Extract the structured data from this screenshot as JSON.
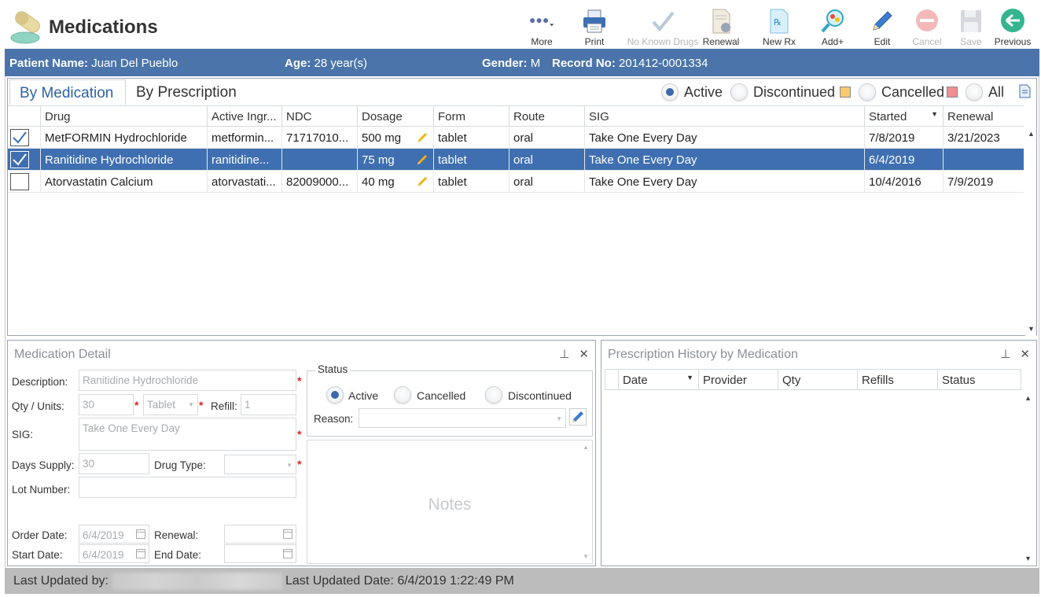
{
  "app": {
    "title": "Medications"
  },
  "toolbar": {
    "more": "More",
    "print": "Print",
    "no_known_drugs": "No Known Drugs",
    "renewal": "Renewal",
    "new_rx": "New Rx",
    "add": "Add+",
    "edit": "Edit",
    "cancel": "Cancel",
    "save": "Save",
    "previous": "Previous"
  },
  "patient": {
    "name_label": "Patient Name:",
    "name": "Juan Del Pueblo",
    "age_label": "Age:",
    "age": "28 year(s)",
    "gender_label": "Gender:",
    "gender": "M",
    "record_label": "Record No:",
    "record": "201412-0001334"
  },
  "tabs": {
    "by_medication": "By Medication",
    "by_prescription": "By Prescription"
  },
  "filters": {
    "active": "Active",
    "discontinued": "Discontinued",
    "cancelled": "Cancelled",
    "all": "All",
    "discontinued_color": "#f7c970",
    "cancelled_color": "#ef8f92",
    "selected": "Active"
  },
  "grid": {
    "headers": [
      "Drug",
      "Active Ingr...",
      "NDC",
      "Dosage",
      "Form",
      "Route",
      "SIG",
      "Started",
      "Renewal"
    ],
    "rows": [
      {
        "checked": true,
        "drug": "MetFORMIN Hydrochloride",
        "ingredient": "metformin...",
        "ndc": "71717010...",
        "dosage": "500 mg",
        "form": "tablet",
        "route": "oral",
        "sig": "Take One Every Day",
        "started": "7/8/2019",
        "renewal": "3/21/2023"
      },
      {
        "checked": true,
        "drug": "Ranitidine Hydrochloride",
        "ingredient": "ranitidine...",
        "ndc": "",
        "dosage": "75 mg",
        "form": "tablet",
        "route": "oral",
        "sig": "Take One Every Day",
        "started": "6/4/2019",
        "renewal": "",
        "selected": true
      },
      {
        "checked": false,
        "drug": "Atorvastatin Calcium",
        "ingredient": "atorvastati...",
        "ndc": "82009000...",
        "dosage": "40 mg",
        "form": "tablet",
        "route": "oral",
        "sig": "Take One Every Day",
        "started": "10/4/2016",
        "renewal": "7/9/2019"
      }
    ]
  },
  "detail": {
    "title": "Medication Detail",
    "description_label": "Description:",
    "description": "Ranitidine Hydrochloride",
    "qty_label": "Qty / Units:",
    "qty": "30",
    "units": "Tablet",
    "refill_label": "Refill:",
    "refill": "1",
    "sig_label": "SIG:",
    "sig": "Take One Every Day",
    "days_label": "Days Supply:",
    "days": "30",
    "drug_type_label": "Drug Type:",
    "drug_type": "",
    "lot_label": "Lot Number:",
    "lot": "",
    "order_date_label": "Order Date:",
    "order_date": "6/4/2019",
    "renewal_label": "Renewal:",
    "renewal": "",
    "start_date_label": "Start Date:",
    "start_date": "6/4/2019",
    "end_date_label": "End Date:",
    "end_date": "",
    "status_legend": "Status",
    "status_active": "Active",
    "status_cancelled": "Cancelled",
    "status_discontinued": "Discontinued",
    "reason_label": "Reason:",
    "reason": "",
    "notes_placeholder": "Notes"
  },
  "history": {
    "title": "Prescription History by Medication",
    "headers": [
      "Date",
      "Provider",
      "Qty",
      "Refills",
      "Status"
    ]
  },
  "footer": {
    "updated_by_label": "Last Updated by:",
    "updated_date_label": "Last Updated Date:",
    "updated_date": "6/4/2019 1:22:49 PM"
  }
}
